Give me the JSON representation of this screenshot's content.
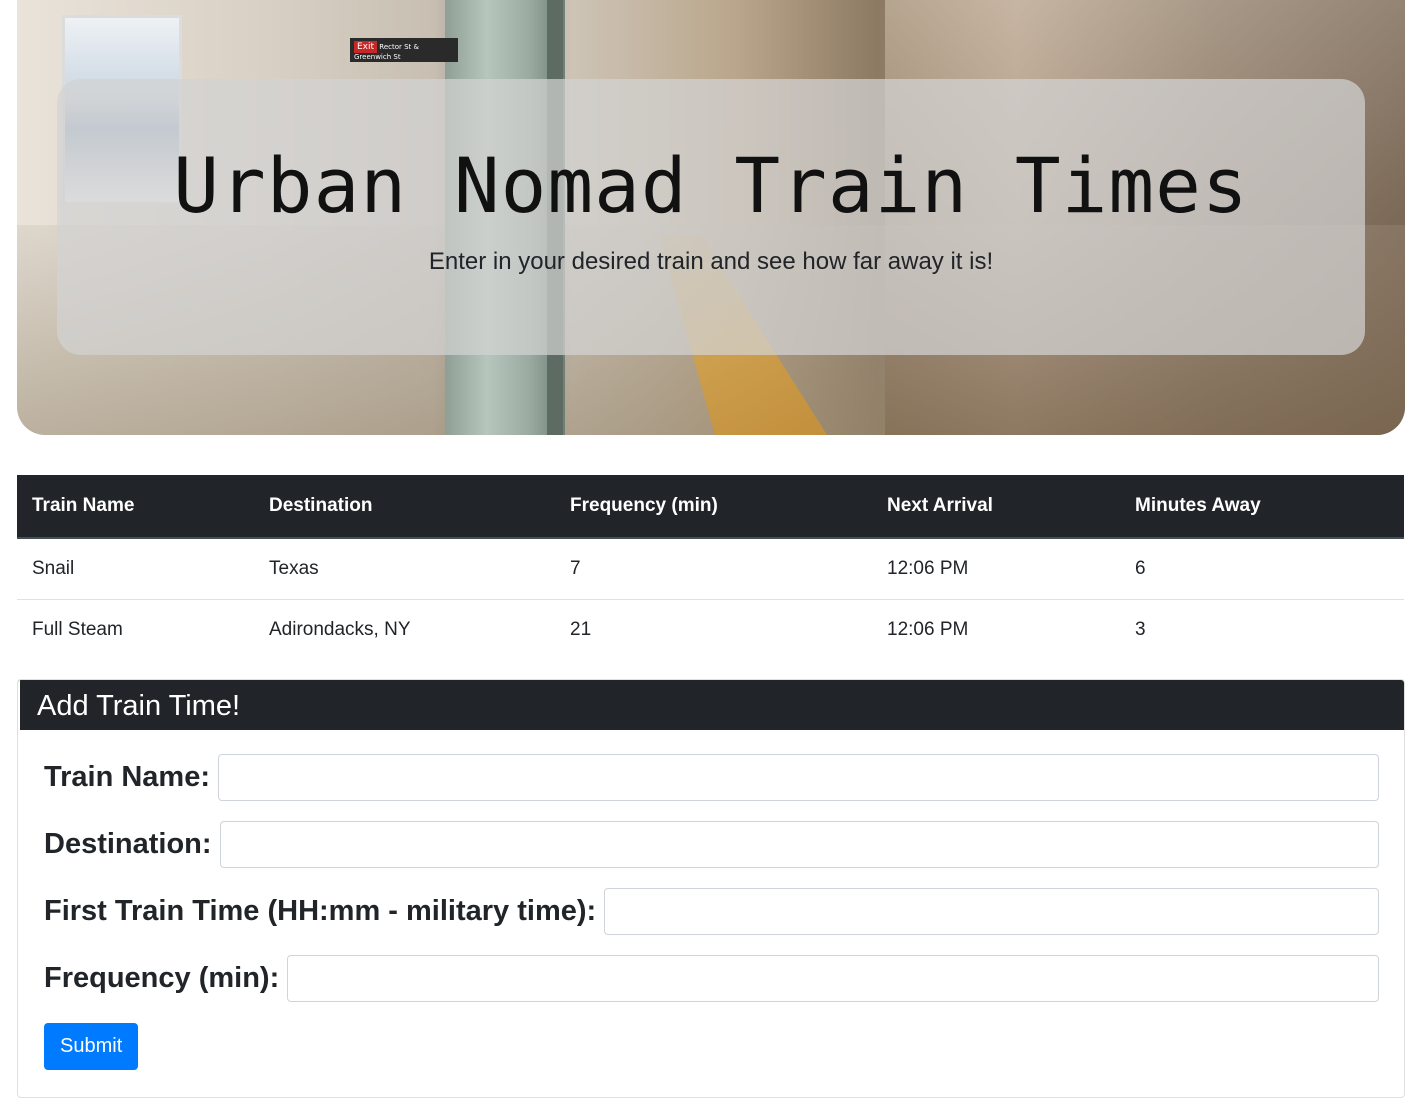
{
  "header": {
    "title": "Urban Nomad Train Times",
    "subtitle": "Enter in your desired train and see how far away it is!",
    "exit_sign": "Exit",
    "exit_sign_street": "Rector St & Greenwich St"
  },
  "table": {
    "columns": [
      "Train Name",
      "Destination",
      "Frequency (min)",
      "Next Arrival",
      "Minutes Away"
    ],
    "rows": [
      [
        "Snail",
        "Texas",
        "7",
        "12:06 PM",
        "6"
      ],
      [
        "Full Steam",
        "Adirondacks, NY",
        "21",
        "12:06 PM",
        "3"
      ]
    ]
  },
  "form": {
    "title": "Add Train Time!",
    "train_name_label": "Train Name:",
    "destination_label": "Destination:",
    "first_time_label": "First Train Time (HH:mm - military time):",
    "frequency_label": "Frequency (min):",
    "train_name_value": "",
    "destination_value": "",
    "first_time_value": "",
    "frequency_value": "",
    "submit_label": "Submit"
  },
  "colors": {
    "header_dark": "#212529",
    "primary": "#007bff"
  }
}
